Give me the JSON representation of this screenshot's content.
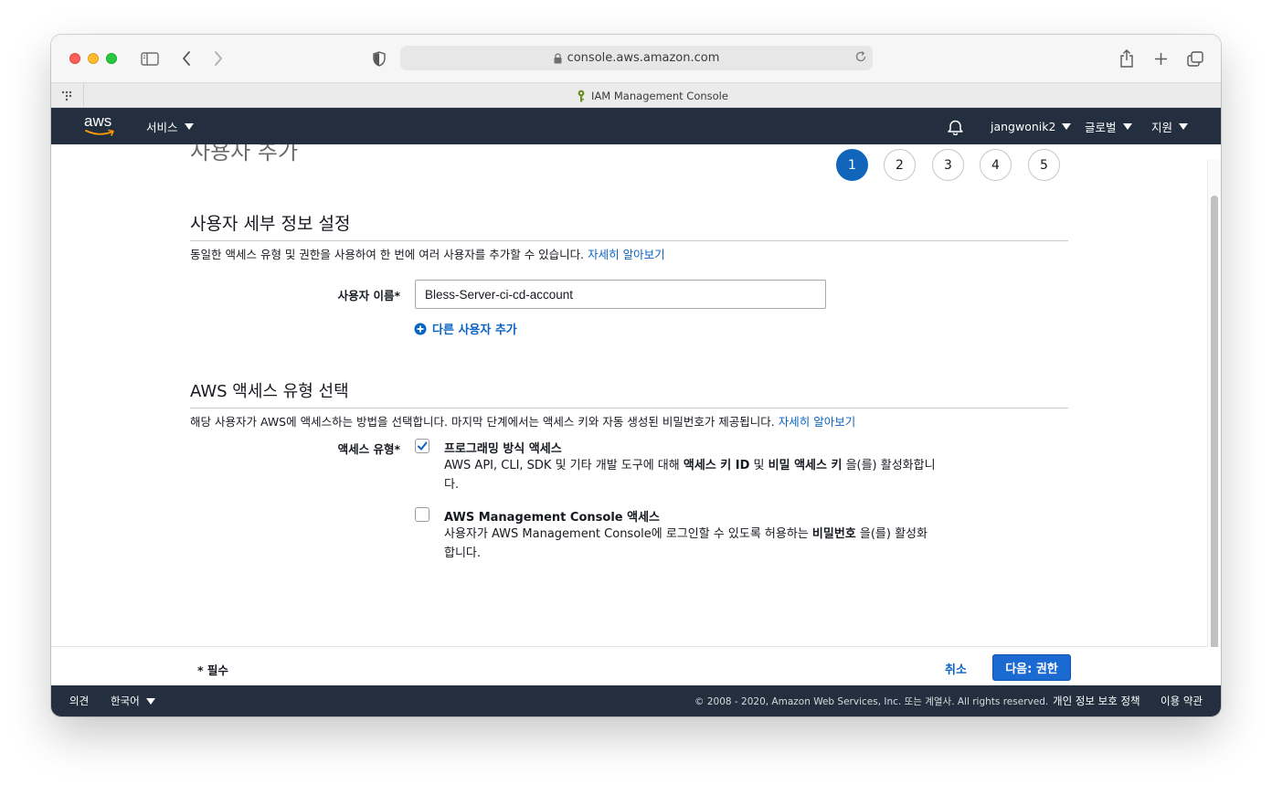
{
  "browser": {
    "url": "console.aws.amazon.com",
    "tab_title": "IAM Management Console"
  },
  "nav": {
    "logo": "aws",
    "services": "서비스",
    "account": "jangwonik2",
    "region": "글로벌",
    "support": "지원"
  },
  "page": {
    "title": "사용자 추가",
    "steps": [
      "1",
      "2",
      "3",
      "4",
      "5"
    ],
    "active_step": 1
  },
  "user_details": {
    "heading": "사용자 세부 정보 설정",
    "description": "동일한 액세스 유형 및 권한을 사용하여 한 번에 여러 사용자를 추가할 수 있습니다.",
    "learn_more": "자세히 알아보기",
    "username_label": "사용자 이름*",
    "username_value": "Bless-Server-ci-cd-account",
    "add_user": "다른 사용자 추가"
  },
  "access_type": {
    "heading": "AWS 액세스 유형 선택",
    "description": "해당 사용자가 AWS에 액세스하는 방법을 선택합니다. 마지막 단계에서는 액세스 키와 자동 생성된 비밀번호가 제공됩니다.",
    "learn_more": "자세히 알아보기",
    "label": "액세스 유형*",
    "programmatic": {
      "title": "프로그래밍 방식 액세스",
      "checked": true,
      "desc_1": "AWS API, CLI, SDK 및 기타 개발 도구에 대해 ",
      "desc_bold_1": "액세스 키 ID",
      "desc_2": " 및 ",
      "desc_bold_2": "비밀 액세스 키",
      "desc_3": " 을(를) 활성화합니다."
    },
    "console": {
      "title": "AWS Management Console 액세스",
      "checked": false,
      "desc_1": "사용자가 AWS Management Console에 로그인할 수 있도록 허용하는 ",
      "desc_bold": "비밀번호",
      "desc_2": " 을(를) 활성화합니다."
    }
  },
  "actions": {
    "required_note": "* 필수",
    "cancel": "취소",
    "next": "다음: 권한"
  },
  "footer": {
    "feedback": "의견",
    "language": "한국어",
    "copyright": "© 2008 - 2020, Amazon Web Services, Inc. 또는 계열사. All rights reserved.",
    "privacy": "개인 정보 보호 정책",
    "terms": "이용 약관"
  },
  "colors": {
    "nav_bg": "#232f3e",
    "accent_blue": "#1166bb",
    "link_blue": "#0b63c4",
    "aws_orange": "#ff9900"
  },
  "icons": {
    "sidebar": "sidebar-icon",
    "back": "chevron-left-icon",
    "forward": "chevron-right-icon",
    "privacy": "shield-icon",
    "lock": "lock-icon",
    "reload": "reload-icon",
    "share": "share-icon",
    "new_tab": "plus-icon",
    "tabs": "tabs-overview-icon",
    "notifications": "bell-icon",
    "add": "plus-circle-icon",
    "check": "checkmark-icon"
  }
}
